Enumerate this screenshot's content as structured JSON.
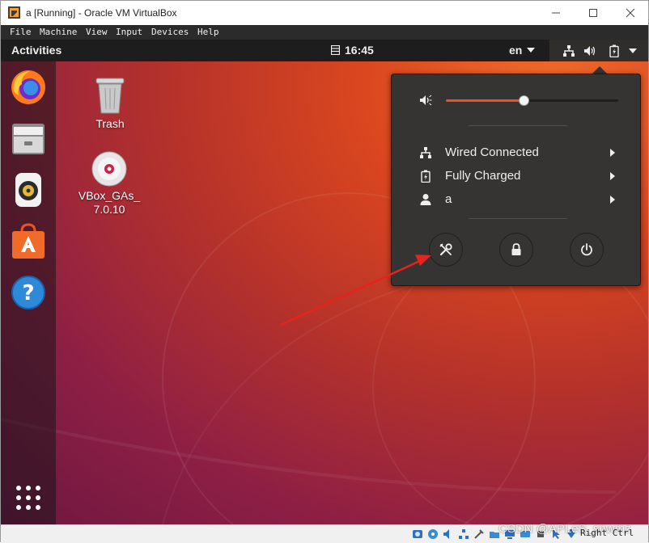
{
  "window": {
    "title": "a [Running] - Oracle VM VirtualBox",
    "minimize_icon": "minimize-icon",
    "maximize_icon": "maximize-icon",
    "close_icon": "close-icon"
  },
  "menubar": {
    "items": [
      "File",
      "Machine",
      "View",
      "Input",
      "Devices",
      "Help"
    ]
  },
  "topbar": {
    "activities": "Activities",
    "clock": "16:45",
    "language": "en"
  },
  "dock": {
    "items": [
      "firefox-icon",
      "files-icon",
      "rhythmbox-icon",
      "software-icon",
      "help-icon",
      "show-apps-icon"
    ]
  },
  "desktop": {
    "icons": [
      {
        "label": "Trash"
      },
      {
        "label": "VBox_GAs_\n7.0.10"
      }
    ]
  },
  "system_menu": {
    "volume_level": 0.45,
    "items": [
      {
        "label": "Wired Connected",
        "icon": "network-icon"
      },
      {
        "label": "Fully Charged",
        "icon": "battery-icon"
      },
      {
        "label": "a",
        "icon": "user-icon"
      }
    ],
    "buttons": [
      "settings-icon",
      "lock-icon",
      "power-icon"
    ]
  },
  "statusbar": {
    "host_key": "Right Ctrl"
  },
  "watermark": "CSDN @APLeS_snwmz",
  "colors": {
    "accent": "#e95420",
    "panel": "#1d1d1d",
    "menu": "#353432"
  }
}
